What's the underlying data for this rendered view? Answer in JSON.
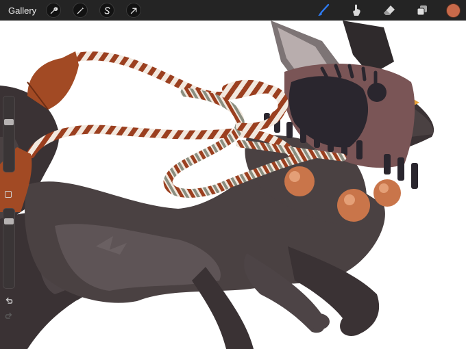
{
  "app": {
    "gallery_label": "Gallery"
  },
  "toolbar": {
    "left_tools": [
      {
        "name": "actions",
        "icon": "wrench-icon"
      },
      {
        "name": "adjustments",
        "icon": "magic-wand-icon"
      },
      {
        "name": "selection",
        "icon": "selection-s-icon"
      },
      {
        "name": "transform",
        "icon": "arrow-cursor-icon"
      }
    ],
    "right_tools": [
      {
        "name": "brush",
        "icon": "brush-icon",
        "active": true
      },
      {
        "name": "smudge",
        "icon": "smudge-finger-icon",
        "active": false
      },
      {
        "name": "eraser",
        "icon": "eraser-icon",
        "active": false
      },
      {
        "name": "layers",
        "icon": "layers-icon",
        "active": false
      }
    ],
    "current_color": "#c96a4a",
    "active_color": "#2e7cf6"
  },
  "sidebar": {
    "brush_size_level": 0.3,
    "opacity_level": 0.1,
    "icons": [
      "modify-square-icon",
      "undo-icon",
      "redo-icon"
    ]
  },
  "canvas": {
    "background": "#ffffff",
    "colors": {
      "fur_dark": "#3a3234",
      "fur_mid": "#4a4142",
      "fur_light": "#5e5456",
      "helmet": "#7a5556",
      "helmet_dark": "#2a262e",
      "rope_red": "#9b3f1f",
      "rope_cream": "#f2e8de",
      "rope_sage": "#8a8e80",
      "tassel": "#a24a24",
      "bead": "#c9754a",
      "bead_highlight": "#f0b08a"
    }
  }
}
